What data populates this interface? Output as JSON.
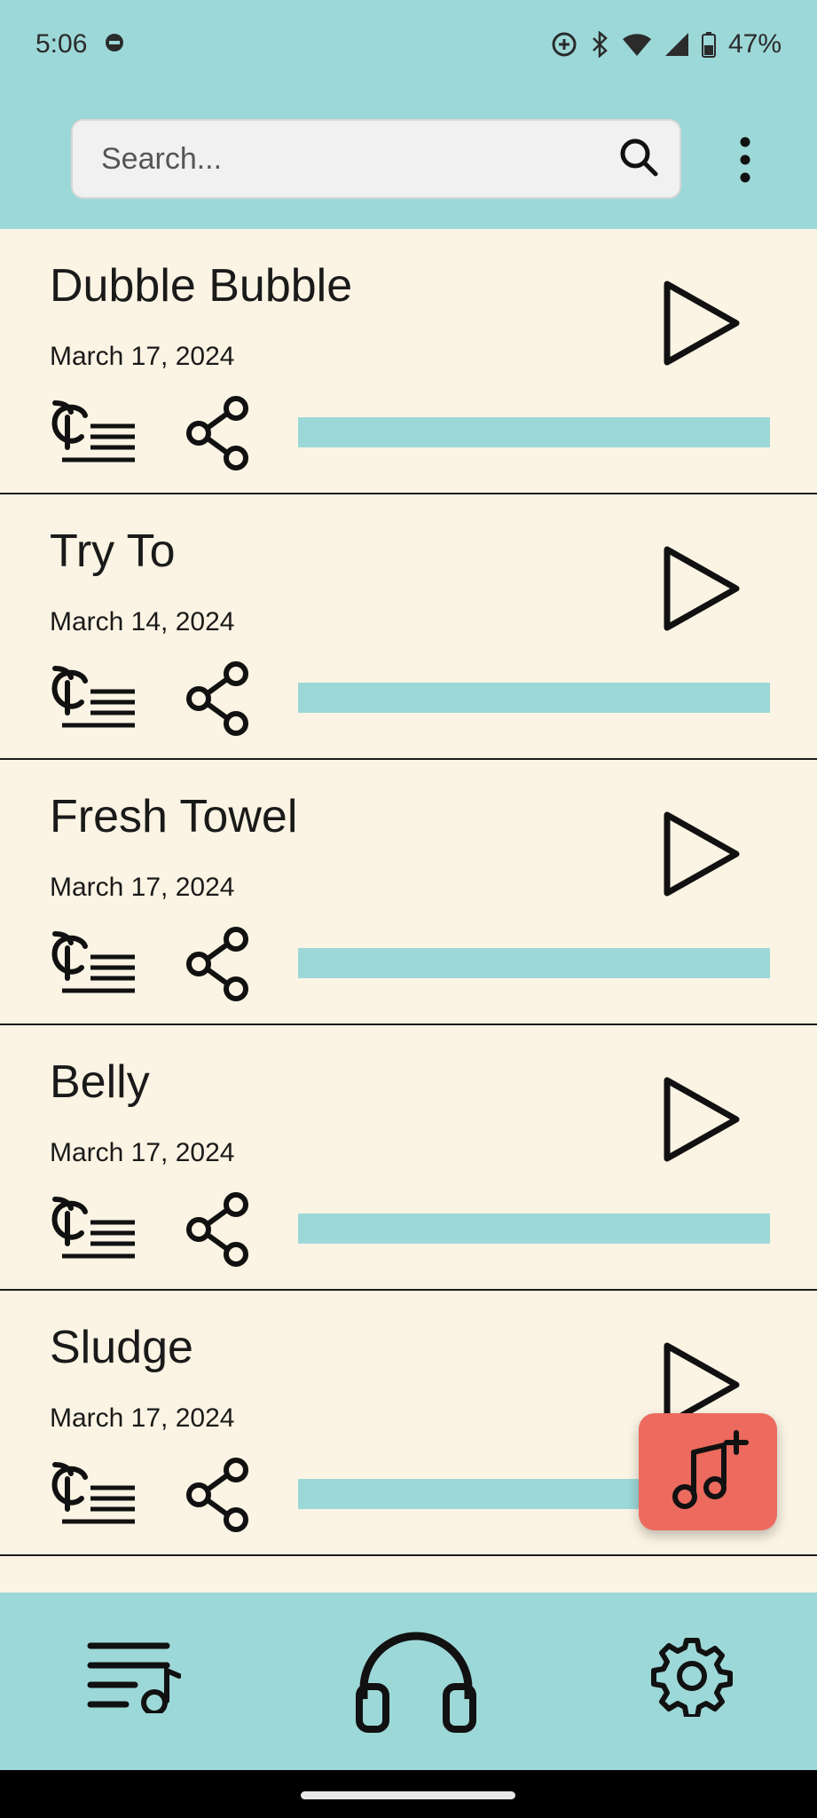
{
  "status_bar": {
    "time": "5:06",
    "battery": "47%"
  },
  "search": {
    "placeholder": "Search..."
  },
  "songs": [
    {
      "title": "Dubble Bubble",
      "date": "March 17, 2024",
      "progress": 0
    },
    {
      "title": "Try To",
      "date": "March 14, 2024",
      "progress": 0
    },
    {
      "title": "Fresh Towel",
      "date": "March 17, 2024",
      "progress": 0
    },
    {
      "title": "Belly",
      "date": "March 17, 2024",
      "progress": 0
    },
    {
      "title": "Sludge",
      "date": "March 17, 2024",
      "progress": 0
    }
  ],
  "colors": {
    "header_bg": "#9dd8d8",
    "list_bg": "#fbf4e4",
    "fab_bg": "#ec6a5e",
    "progress_track": "#9dd8d8"
  },
  "icons": {
    "search": "search-icon",
    "more": "more-vertical-icon",
    "play": "play-icon",
    "lyrics": "lyrics-icon",
    "share": "share-icon",
    "add_music": "add-music-icon",
    "playlist": "playlist-icon",
    "headphones": "headphones-icon",
    "settings": "settings-gear-icon"
  }
}
